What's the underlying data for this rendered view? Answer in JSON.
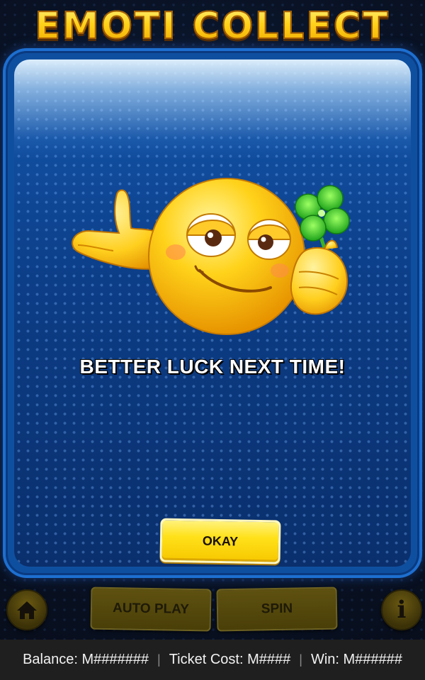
{
  "header": {
    "title": "EMOTI COLLECT"
  },
  "popup": {
    "message": "BETTER LUCK NEXT TIME!",
    "okay_label": "OKAY",
    "emoji": "smiling-emoji-with-four-leaf-clover"
  },
  "controls": {
    "home_icon": "home-icon",
    "autoplay_label": "AUTO PLAY",
    "spin_label": "SPIN",
    "info_icon": "info-icon",
    "info_glyph": "i"
  },
  "status": {
    "balance": "Balance: M#######",
    "ticket_cost": "Ticket Cost: M####",
    "win": "Win: M######",
    "separator": "|"
  },
  "colors": {
    "title": "#ffd21a",
    "panel": "#0f4fa0",
    "okay_button": "#ffe11a",
    "disabled_button": "#4a3f08",
    "status_bar": "#1f1f1f"
  }
}
